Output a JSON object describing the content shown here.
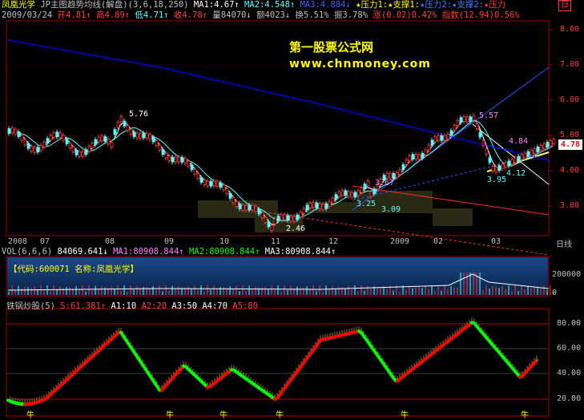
{
  "header": {
    "stock_name": "凤凰光学",
    "indicator": "JP主图趋势均线(解盘)",
    "params": "(3,6,18,250)",
    "ma1": "MA1:4.67↑",
    "ma2": "MA2:4.548↑",
    "ma3": "MA3:4.884↓",
    "press1": "★压力1:",
    "support1": "★支撑1:",
    "press2": "★压力2:",
    "support2": "★支撑2:",
    "press3": "★压力",
    "period_btn": "日",
    "date": "2009/03/24",
    "open": "开4.81↑",
    "high": "高4.89↑",
    "low": "低4.71↑",
    "close": "收4.78↑",
    "volume": "量84070↓",
    "amount": "额4023↓",
    "turnover": "换5.51%",
    "amplitude": "振3.78%",
    "change": "涨(0.02)0.42%",
    "index": "指数(12.94)0.56%"
  },
  "watermark": {
    "title": "第一股票公式网",
    "url": "www.chnmoney.com"
  },
  "price_axis": {
    "ticks": [
      "8.00",
      "7.00",
      "6.00",
      "5.00",
      "4.00",
      "3.00"
    ],
    "current": "4.78"
  },
  "price_annotations": [
    "5.76",
    "5.57",
    "4.84",
    "4.12",
    "3.95",
    "3.67",
    "3.25",
    "3.09",
    "2.46"
  ],
  "time_axis": {
    "labels": [
      "2008",
      "07",
      "08",
      "09",
      "10",
      "11",
      "12",
      "2009",
      "02",
      "03"
    ],
    "period": "日线"
  },
  "volume_panel": {
    "title": "VOL(6,6,6)",
    "vol_value": "84069.641↓",
    "ma1": "MA1:80908.844↑",
    "ma2": "MA2:80908.844↑",
    "ma3": "MA3:80908.844↑",
    "code_label": "【代码:600071 名称:凤凰光学】",
    "axis_ticks": [
      "200000",
      "0"
    ]
  },
  "osc_panel": {
    "title": "铁锅炒股(5)",
    "s": "S:61.381↑",
    "a1": "A1:10",
    "a2": "A2:20",
    "a3": "A3:50",
    "a4": "A4:70",
    "a5": "A5:80",
    "axis_ticks": [
      "80.00",
      "60.00",
      "40.00",
      "20.00"
    ],
    "markers": [
      "牛",
      "牛",
      "牛",
      "牛",
      "牛",
      "牛"
    ]
  },
  "colors": {
    "up": "#ff3c3c",
    "down": "#54ffff",
    "ma1": "#ffffff",
    "ma2": "#ffff00",
    "ma3": "#0000ff",
    "border": "#a00000",
    "osc_up": "#ff0000",
    "osc_down": "#00ff00"
  }
}
